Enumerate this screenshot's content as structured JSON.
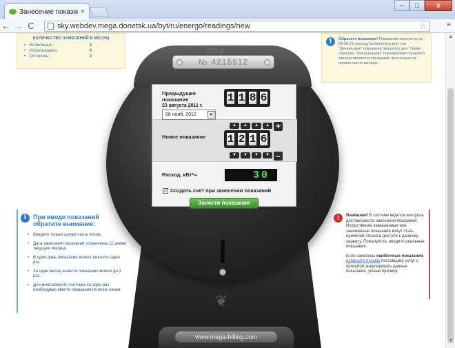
{
  "browser": {
    "tab_title": "Занесение показаний < ",
    "tab_close": "×",
    "url": "sky.webdev.mega.donetsk.ua/byt/ru/energo/readings/new",
    "nav_back": "←",
    "nav_forward": "→",
    "nav_reload": "C",
    "window_minimize": "–",
    "window_maximize": "□",
    "window_close": "x",
    "star": "☆",
    "menu": "≡"
  },
  "quota": {
    "title": "КОЛИЧЕСТВО ЗАНЕСЕНИЙ В МЕСЯЦ",
    "rows": [
      {
        "label": "Возможных:",
        "value": "3"
      },
      {
        "label": "Использовано:",
        "value": "0"
      },
      {
        "label": "Осталось:",
        "value": "3"
      }
    ]
  },
  "notice_top": {
    "heading": "Обратите внимание!",
    "text": " Показания заносятся на 00:00:01 секунду выбранного дня, как \"финальные\" показания прошлого дня. Таким образом, \"финальными\" показаниями прошлого месяца являются показания, внесенные на первое число месяца."
  },
  "meter": {
    "model": "СО-2",
    "serial": "№ 4215512",
    "prev_label": "Предыдущее показание",
    "prev_date": "23 августа 2011 г.",
    "prev_digits": [
      "1",
      "1",
      "8",
      "6"
    ],
    "new_label": "Новое показание",
    "new_digits": [
      "1",
      "2",
      "1",
      "6"
    ],
    "date_value": "08 нояб. 2012",
    "arrow_up": "▲",
    "arrow_down": "▼",
    "plus": "+",
    "minus": "–",
    "usage_label": "Расход, кВт*ч",
    "usage_value": "30",
    "create_invoice_label": "Создать счет при занесении показаний",
    "create_invoice_checked": true,
    "submit_label": "Занести показания",
    "brand": "www.mega-billing.com"
  },
  "left_tip": {
    "heading": "При вводе показаний обратите внимание:",
    "items": [
      "Вводите только целую часть числа.",
      "Дата занесения показаний ограничена 12 днями текущего месяца.",
      "В один день показания можно заносить один раз.",
      "За один месяц занести показания можно до 3 раз.",
      "Для многозонного счетчика за один раз необходимо ввести показания по всем зонам."
    ]
  },
  "right_warn": {
    "heading": "Внимание!",
    "text1": " В системе ведется контроль достоверности занесения показаний. Искусственно завышенные или заниженные показания могут стать причиной отказа в доступе к данному сервису. Пожалуйста, вводите реальные показания.",
    "text2_pre": "Если занесены ",
    "text2_bold": "ошибочные показания",
    "text2_mid": ", ",
    "link": "напишите письмо",
    "text2_post": " поставщику услуг с просьбой аннулировать данные показания, указав причину."
  }
}
